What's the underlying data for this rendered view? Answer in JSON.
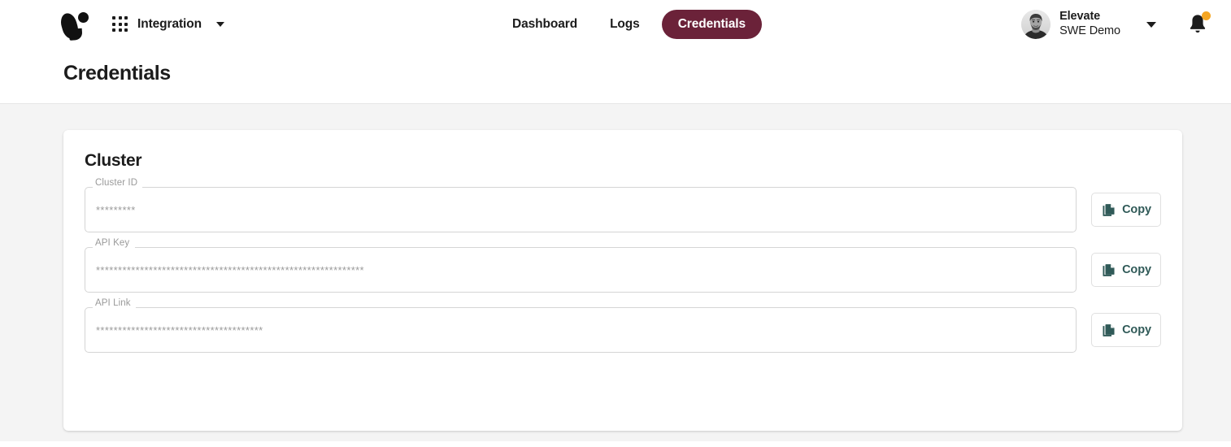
{
  "header": {
    "logo_name": "brand-logo",
    "apps_icon": "apps-grid-icon",
    "workspace": "Integration",
    "workspace_caret": "chevron-down-icon",
    "nav": [
      {
        "label": "Dashboard",
        "active": false
      },
      {
        "label": "Logs",
        "active": false
      },
      {
        "label": "Credentials",
        "active": true
      }
    ],
    "user": {
      "avatar": "user-avatar-photo",
      "org": "Elevate",
      "subtitle": "SWE Demo",
      "caret": "chevron-down-icon"
    },
    "notifications": {
      "icon": "bell-icon",
      "has_unread": true,
      "dot_color": "#F5A623"
    }
  },
  "page": {
    "title": "Credentials"
  },
  "card": {
    "title": "Cluster",
    "fields": [
      {
        "label": "Cluster ID",
        "value": "*********",
        "copy_label": "Copy"
      },
      {
        "label": "API Key",
        "value": "*************************************************************",
        "copy_label": "Copy"
      },
      {
        "label": "API Link",
        "value": "**************************************",
        "copy_label": "Copy"
      }
    ]
  },
  "colors": {
    "accent_active_tab": "#6B2239",
    "copy_button_text": "#305A58",
    "page_background": "#F4F4F4",
    "card_background": "#FFFFFF",
    "notification_dot": "#F5A623"
  }
}
